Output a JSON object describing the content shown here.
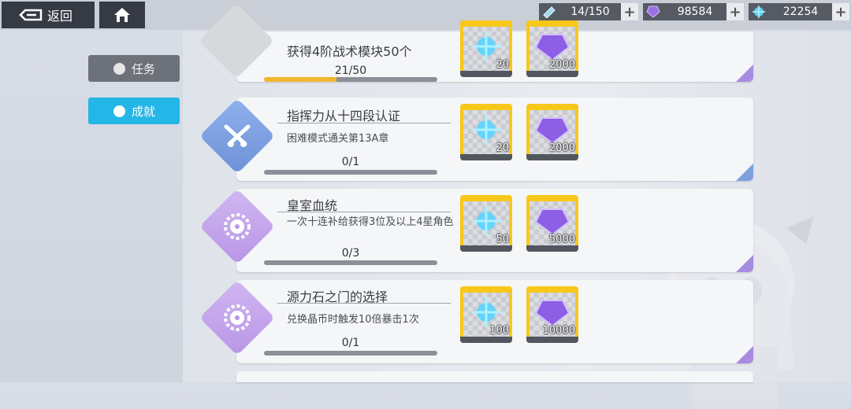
{
  "topbar": {
    "back_label": "返回",
    "resources": [
      {
        "icon": "ticket-icon",
        "value": "14/150"
      },
      {
        "icon": "purple-crystal-icon",
        "value": "98584"
      },
      {
        "icon": "blue-orb-icon",
        "value": "22254"
      }
    ],
    "plus": "+"
  },
  "sidebar": {
    "tabs": [
      {
        "label": "任务",
        "selected": false
      },
      {
        "label": "成就",
        "selected": true
      }
    ]
  },
  "achievements": [
    {
      "title": "获得4阶战术模块50个",
      "progress_text": "21/50",
      "progress": 0.42,
      "emblem": "gray",
      "rewards": [
        {
          "icon": "blue-orb-icon",
          "qty": "20"
        },
        {
          "icon": "purple-crystal-icon",
          "qty": "2000"
        }
      ]
    },
    {
      "title": "指挥力从十四段认证",
      "desc": "困难模式通关第13A章",
      "progress_text": "0/1",
      "progress": 0,
      "emblem": "blue",
      "rewards": [
        {
          "icon": "blue-orb-icon",
          "qty": "20"
        },
        {
          "icon": "purple-crystal-icon",
          "qty": "2000"
        }
      ]
    },
    {
      "title": "皇室血统",
      "desc": "一次十连补给获得3位及以上4星角色",
      "progress_text": "0/3",
      "progress": 0,
      "emblem": "purple",
      "rewards": [
        {
          "icon": "blue-orb-icon",
          "qty": "50"
        },
        {
          "icon": "purple-crystal-icon",
          "qty": "5000"
        }
      ]
    },
    {
      "title": "源力石之门的选择",
      "desc": "兑换晶币时触发10倍暴击1次",
      "progress_text": "0/1",
      "progress": 0,
      "emblem": "purple",
      "rewards": [
        {
          "icon": "blue-orb-icon",
          "qty": "100"
        },
        {
          "icon": "purple-crystal-icon",
          "qty": "10000"
        }
      ]
    }
  ]
}
